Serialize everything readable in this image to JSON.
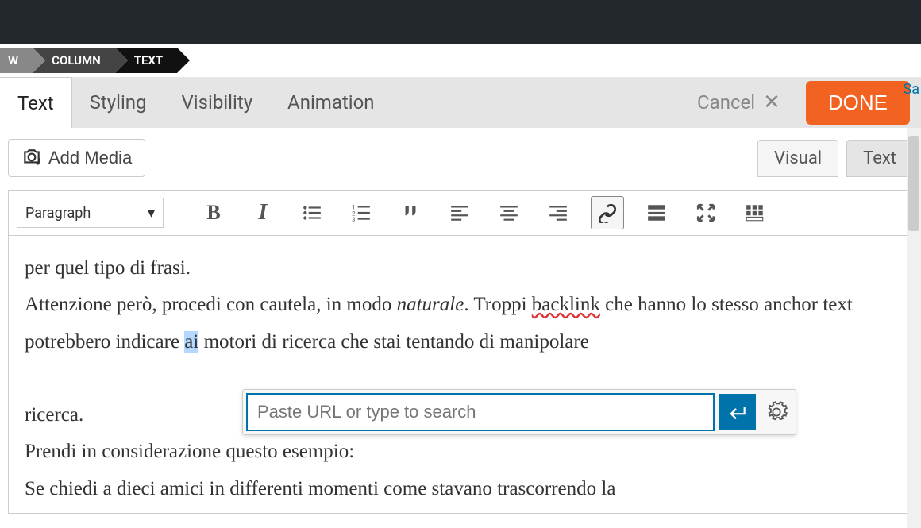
{
  "breadcrumb": {
    "row": "W",
    "column": "COLUMN",
    "text": "TEXT"
  },
  "tabs": {
    "text": "Text",
    "styling": "Styling",
    "visibility": "Visibility",
    "animation": "Animation"
  },
  "actions": {
    "cancel": "Cancel",
    "done": "DONE",
    "saved_partial": "Sa"
  },
  "media": {
    "add": "Add Media"
  },
  "editor_tabs": {
    "visual": "Visual",
    "text": "Text"
  },
  "toolbar": {
    "format": "Paragraph"
  },
  "content": {
    "line1": "per quel tipo di frasi.",
    "line2a": "Attenzione però, procedi con cautela, in modo ",
    "line2b": "naturale",
    "line2c": ". Troppi ",
    "line2d": "backlink",
    "line2e": " che hanno lo stesso anchor text potrebbero indicare ",
    "line2sel": "ai",
    "line2f": " motori di ricerca che stai tentando di manipolare",
    "line3": "ricerca.",
    "line4": "Prendi in considerazione questo esempio:",
    "line5": "Se chiedi a dieci amici in differenti momenti come stavano trascorrendo la"
  },
  "link_popup": {
    "placeholder": "Paste URL or type to search"
  }
}
